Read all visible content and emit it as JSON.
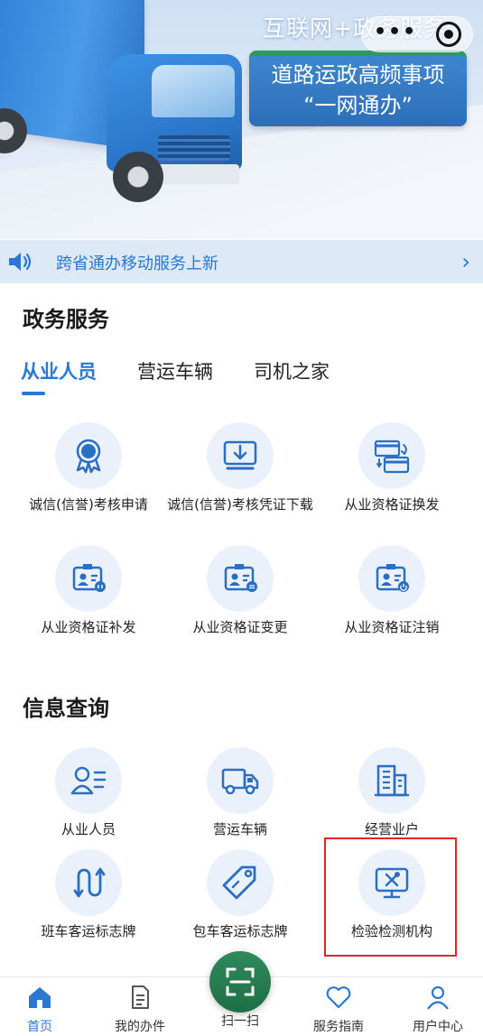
{
  "banner": {
    "headline": "互联网+政务服务",
    "badge_line1": "道路运政高频事项",
    "badge_line2": "“一网通办”",
    "capsule_menu": "•••"
  },
  "notice": {
    "text": "跨省通办移动服务上新",
    "arrow": "›"
  },
  "gov_services": {
    "title": "政务服务",
    "tabs": [
      {
        "label": "从业人员",
        "active": true
      },
      {
        "label": "营运车辆",
        "active": false
      },
      {
        "label": "司机之家",
        "active": false
      }
    ],
    "items": [
      {
        "label": "诚信(信誉)考核申请",
        "icon": "credit-award-icon"
      },
      {
        "label": "诚信(信誉)考核凭证下载",
        "icon": "download-certificate-icon"
      },
      {
        "label": "从业资格证换发",
        "icon": "card-exchange-icon"
      },
      {
        "label": "从业资格证补发",
        "icon": "id-card-reissue-icon"
      },
      {
        "label": "从业资格证变更",
        "icon": "id-card-change-icon"
      },
      {
        "label": "从业资格证注销",
        "icon": "id-card-cancel-icon"
      }
    ]
  },
  "info_query": {
    "title": "信息查询",
    "items": [
      {
        "label": "从业人员",
        "icon": "personnel-icon"
      },
      {
        "label": "营运车辆",
        "icon": "truck-icon"
      },
      {
        "label": "经营业户",
        "icon": "building-icon"
      },
      {
        "label": "班车客运标志牌",
        "icon": "route-icon"
      },
      {
        "label": "包车客运标志牌",
        "icon": "tag-icon"
      },
      {
        "label": "检验检测机构",
        "icon": "inspection-monitor-icon"
      }
    ]
  },
  "bottom_nav": [
    {
      "label": "首页",
      "icon": "home-icon",
      "active": true
    },
    {
      "label": "我的办件",
      "icon": "document-icon",
      "active": false
    },
    {
      "label": "扫一扫",
      "icon": "scan-icon",
      "active": false
    },
    {
      "label": "服务指南",
      "icon": "heart-icon",
      "active": false
    },
    {
      "label": "用户中心",
      "icon": "user-icon",
      "active": false
    }
  ],
  "colors": {
    "accent": "#2a78d2",
    "highlight_box": "#e8232a",
    "scan_button": "#1f6e45",
    "icon_circle_bg": "#eaf1fa"
  }
}
